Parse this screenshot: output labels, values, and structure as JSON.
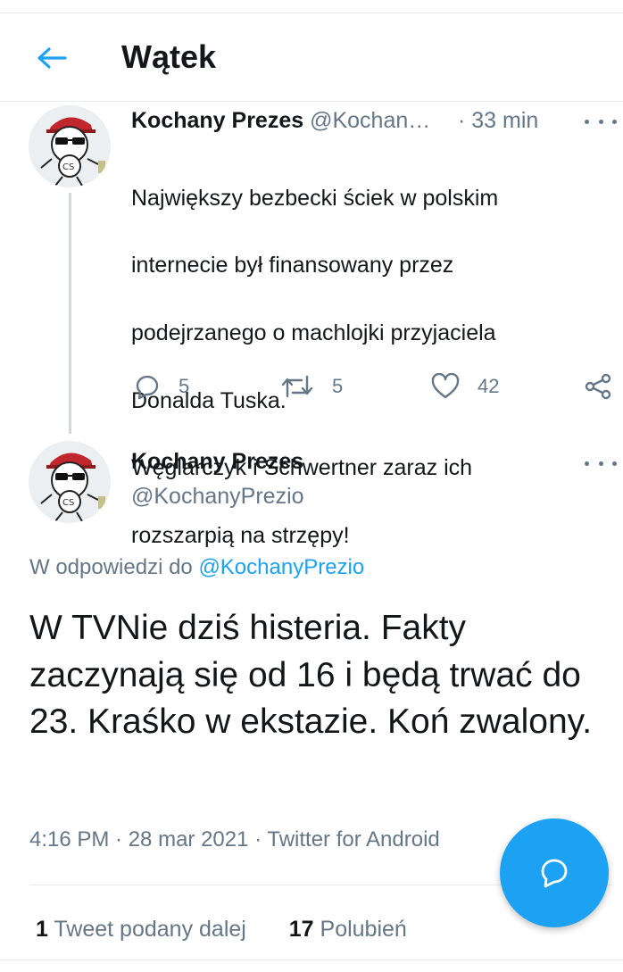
{
  "header": {
    "title": "Wątek"
  },
  "tweet1": {
    "name": "Kochany Prezes",
    "handle": "@Kochan…",
    "time": "· 33 min",
    "lines": [
      "Największy bezbecki ściek w polskim",
      "internecie był finansowany przez",
      "podejrzanego o machlojki przyjaciela",
      "Donalda Tuska.",
      "Węglarczyk i Schwertner zaraz ich",
      "rozszarpią na strzępy!"
    ],
    "replies": "5",
    "retweets": "5",
    "likes": "42"
  },
  "tweet2": {
    "name": "Kochany Prezes",
    "handle": "@KochanyPrezio",
    "reply_prefix": "W odpowiedzi do ",
    "reply_to": "@KochanyPrezio",
    "text": "W TVNie dziś histeria. Fakty zaczynają się od 16 i będą trwać do 23. Kraśko w ekstazie. Koń zwalony.",
    "meta": "4:16 PM · 28 mar 2021 · Twitter for Android",
    "retweet_count": "1",
    "retweet_label": "Tweet podany dalej",
    "like_count": "17",
    "like_label": "Polubień"
  },
  "colors": {
    "accent": "#1da1f2",
    "secondary_text": "#657786",
    "divider": "#e6ecf0"
  },
  "icons": {
    "back": "arrow-left-icon",
    "more": "more-horizontal-icon",
    "reply": "reply-icon",
    "retweet": "retweet-icon",
    "like": "heart-icon",
    "share": "share-icon",
    "compose": "reply-bubble-icon"
  }
}
